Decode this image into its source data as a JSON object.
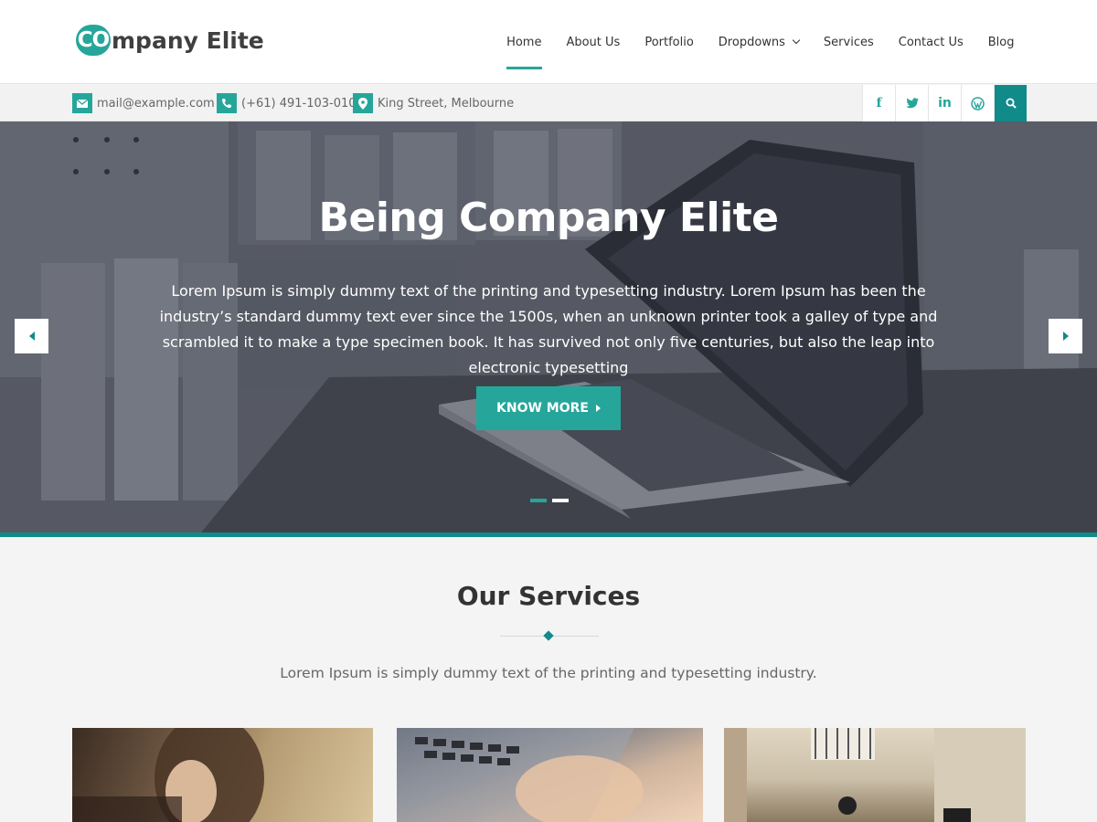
{
  "logo": {
    "badge": "CO",
    "rest": "mpany Elite"
  },
  "nav": [
    {
      "label": "Home",
      "active": true
    },
    {
      "label": "About Us"
    },
    {
      "label": "Portfolio"
    },
    {
      "label": "Dropdowns",
      "has_dropdown": true
    },
    {
      "label": "Services"
    },
    {
      "label": "Contact Us"
    },
    {
      "label": "Blog"
    }
  ],
  "topbar": {
    "email": "mail@example.com",
    "phone": "(+61) 491-103-010",
    "address": "King Street, Melbourne",
    "social": [
      {
        "icon": "facebook-icon",
        "glyph": "f"
      },
      {
        "icon": "twitter-icon",
        "glyph": "t"
      },
      {
        "icon": "linkedin-icon",
        "glyph": "in"
      },
      {
        "icon": "wordpress-icon",
        "glyph": "W"
      },
      {
        "icon": "search-icon"
      }
    ]
  },
  "hero": {
    "title": "Being Company Elite",
    "text": "Lorem Ipsum is simply dummy text of the printing and typesetting industry. Lorem Ipsum has been the industry’s standard dummy text ever since the 1500s, when an unknown printer took a galley of type and scrambled it to make a type specimen book. It has survived not only five centuries, but also the leap into electronic typesetting",
    "cta_label": "KNOW MORE",
    "slides": 2,
    "active_slide": 1
  },
  "services": {
    "title": "Our Services",
    "subtitle": "Lorem Ipsum is simply dummy text of the printing and typesetting industry."
  },
  "colors": {
    "accent": "#26a69a",
    "accent_dark": "#118a8a",
    "text": "#333333"
  }
}
